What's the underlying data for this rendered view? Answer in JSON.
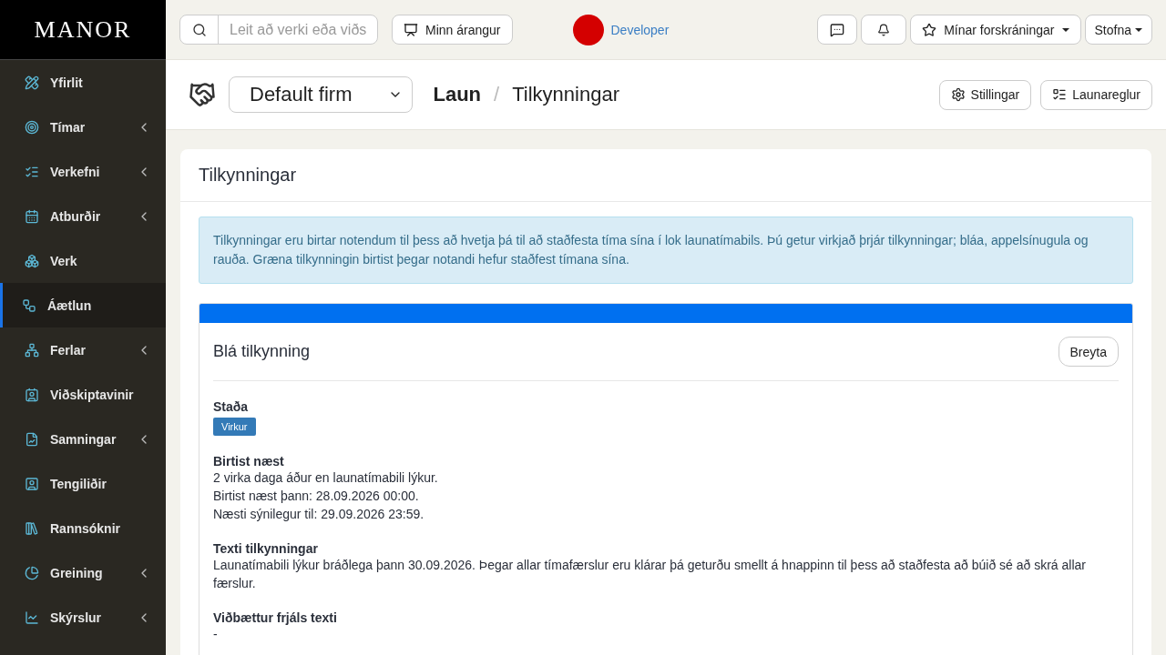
{
  "logo": "MANOR",
  "sidebar": {
    "items": [
      {
        "label": "Yfirlit",
        "expandable": false,
        "selected": false
      },
      {
        "label": "Tímar",
        "expandable": true,
        "selected": false
      },
      {
        "label": "Verkefni",
        "expandable": true,
        "selected": false
      },
      {
        "label": "Atburðir",
        "expandable": true,
        "selected": false
      },
      {
        "label": "Verk",
        "expandable": false,
        "selected": false
      },
      {
        "label": "Áætlun",
        "expandable": false,
        "selected": true
      },
      {
        "label": "Ferlar",
        "expandable": true,
        "selected": false
      },
      {
        "label": "Viðskiptavinir",
        "expandable": false,
        "selected": false
      },
      {
        "label": "Samningar",
        "expandable": true,
        "selected": false
      },
      {
        "label": "Tengiliðir",
        "expandable": false,
        "selected": false
      },
      {
        "label": "Rannsóknir",
        "expandable": false,
        "selected": false
      },
      {
        "label": "Greining",
        "expandable": true,
        "selected": false
      },
      {
        "label": "Skýrslur",
        "expandable": true,
        "selected": false
      }
    ]
  },
  "topbar": {
    "search": {
      "placeholder": "Leit að verki eða viðs"
    },
    "achievement_button": "Minn árangur",
    "user": {
      "name": "Developer",
      "color": "#d40000"
    },
    "favorites_button": "Mínar forskráningar",
    "create_button": "Stofna"
  },
  "header": {
    "firm": "Default firm",
    "breadcrumb": [
      "Laun",
      "Tilkynningar"
    ],
    "breadcrumb_separator": "/",
    "buttons": [
      "Stillingar",
      "Launareglur"
    ]
  },
  "panel": {
    "title": "Tilkynningar",
    "info": "Tilkynningar eru birtar notendum til þess að hvetja þá til að staðfesta tíma sína í lok launatímabils. Þú getur virkjað þrjár tilkynningar; bláa, appelsínugula og rauða. Græna tilkynningin birtist þegar notandi hefur staðfest tímana sína.",
    "notice": {
      "title": "Blá tilkynning",
      "color": "#0070f0",
      "edit_button": "Breyta",
      "fields": [
        {
          "label": "Staða",
          "kind": "badge",
          "lines": [
            "Virkur"
          ]
        },
        {
          "label": "Birtist næst",
          "kind": "text",
          "lines": [
            "2 virka daga áður en launatímabili lýkur.",
            "Birtist næst þann: 28.09.2026 00:00.",
            "Næsti sýnilegur til: 29.09.2026 23:59."
          ]
        },
        {
          "label": "Texti tilkynningar",
          "kind": "text",
          "lines": [
            "Launatímabili lýkur bráðlega þann 30.09.2026. Þegar allar tímafærslur eru klárar þá geturðu smellt á hnappinn til þess að staðfesta að búið sé að skrá allar færslur."
          ]
        },
        {
          "label": "Viðbættur frjáls texti",
          "kind": "text",
          "lines": [
            "-"
          ]
        }
      ]
    }
  }
}
